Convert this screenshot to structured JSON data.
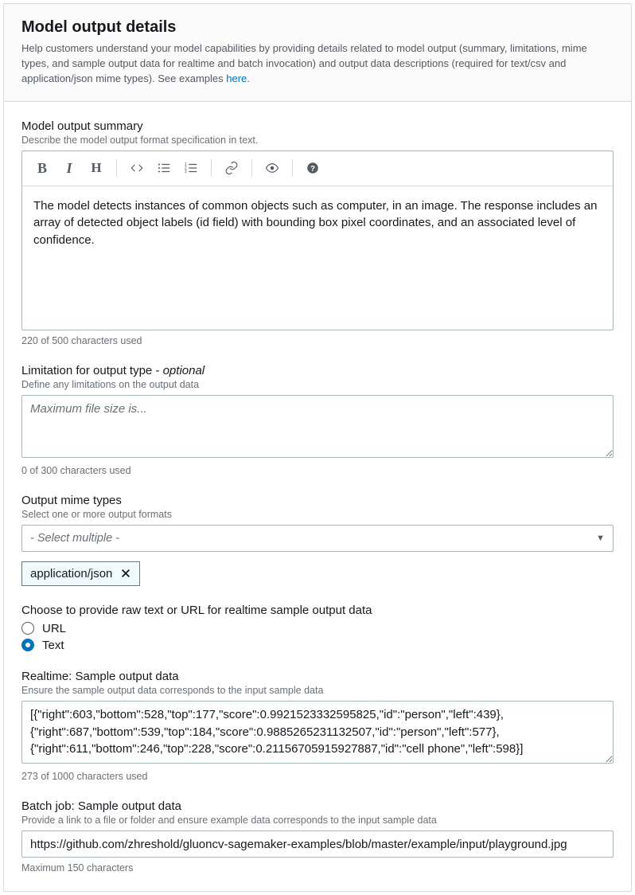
{
  "header": {
    "title": "Model output details",
    "desc_pre": "Help customers understand your model capabilities by providing details related to model output (summary, limitations, mime types, and sample output data for realtime and batch invocation) and output data descriptions (required for text/csv and application/json mime types). See examples ",
    "link": "here",
    "desc_post": "."
  },
  "summary": {
    "label": "Model output summary",
    "desc": "Describe the model output format specification in text.",
    "toolbar": {
      "bold": "B",
      "italic": "I",
      "heading": "H"
    },
    "body": "The model detects instances of common objects such as computer, in an image. The response includes an array of detected object labels (id field) with bounding box pixel coordinates, and an associated level of confidence.",
    "counter": "220 of 500 characters used"
  },
  "limitation": {
    "label_pre": "Limitation for output type - ",
    "label_opt": "optional",
    "desc": "Define any limitations on the output data",
    "placeholder": "Maximum file size is...",
    "value": "",
    "counter": "0 of 300 characters used"
  },
  "mime": {
    "label": "Output mime types",
    "desc": "Select one or more output formats",
    "placeholder": "- Select multiple -",
    "tag": "application/json"
  },
  "sample_choice": {
    "label": "Choose to provide raw text or URL for realtime sample output data",
    "url": "URL",
    "text": "Text",
    "selected": "text"
  },
  "realtime": {
    "label": "Realtime: Sample output data",
    "desc": "Ensure the sample output data corresponds to the input sample data",
    "value": "[{\"right\":603,\"bottom\":528,\"top\":177,\"score\":0.9921523332595825,\"id\":\"person\",\"left\":439},{\"right\":687,\"bottom\":539,\"top\":184,\"score\":0.9885265231132507,\"id\":\"person\",\"left\":577},{\"right\":611,\"bottom\":246,\"top\":228,\"score\":0.21156705915927887,\"id\":\"cell phone\",\"left\":598}]",
    "counter": "273 of 1000 characters used"
  },
  "batch": {
    "label": "Batch job: Sample output data",
    "desc": "Provide a link to a file or folder and ensure example data corresponds to the input sample data",
    "value": "https://github.com/zhreshold/gluoncv-sagemaker-examples/blob/master/example/input/playground.jpg",
    "counter": "Maximum 150 characters"
  }
}
